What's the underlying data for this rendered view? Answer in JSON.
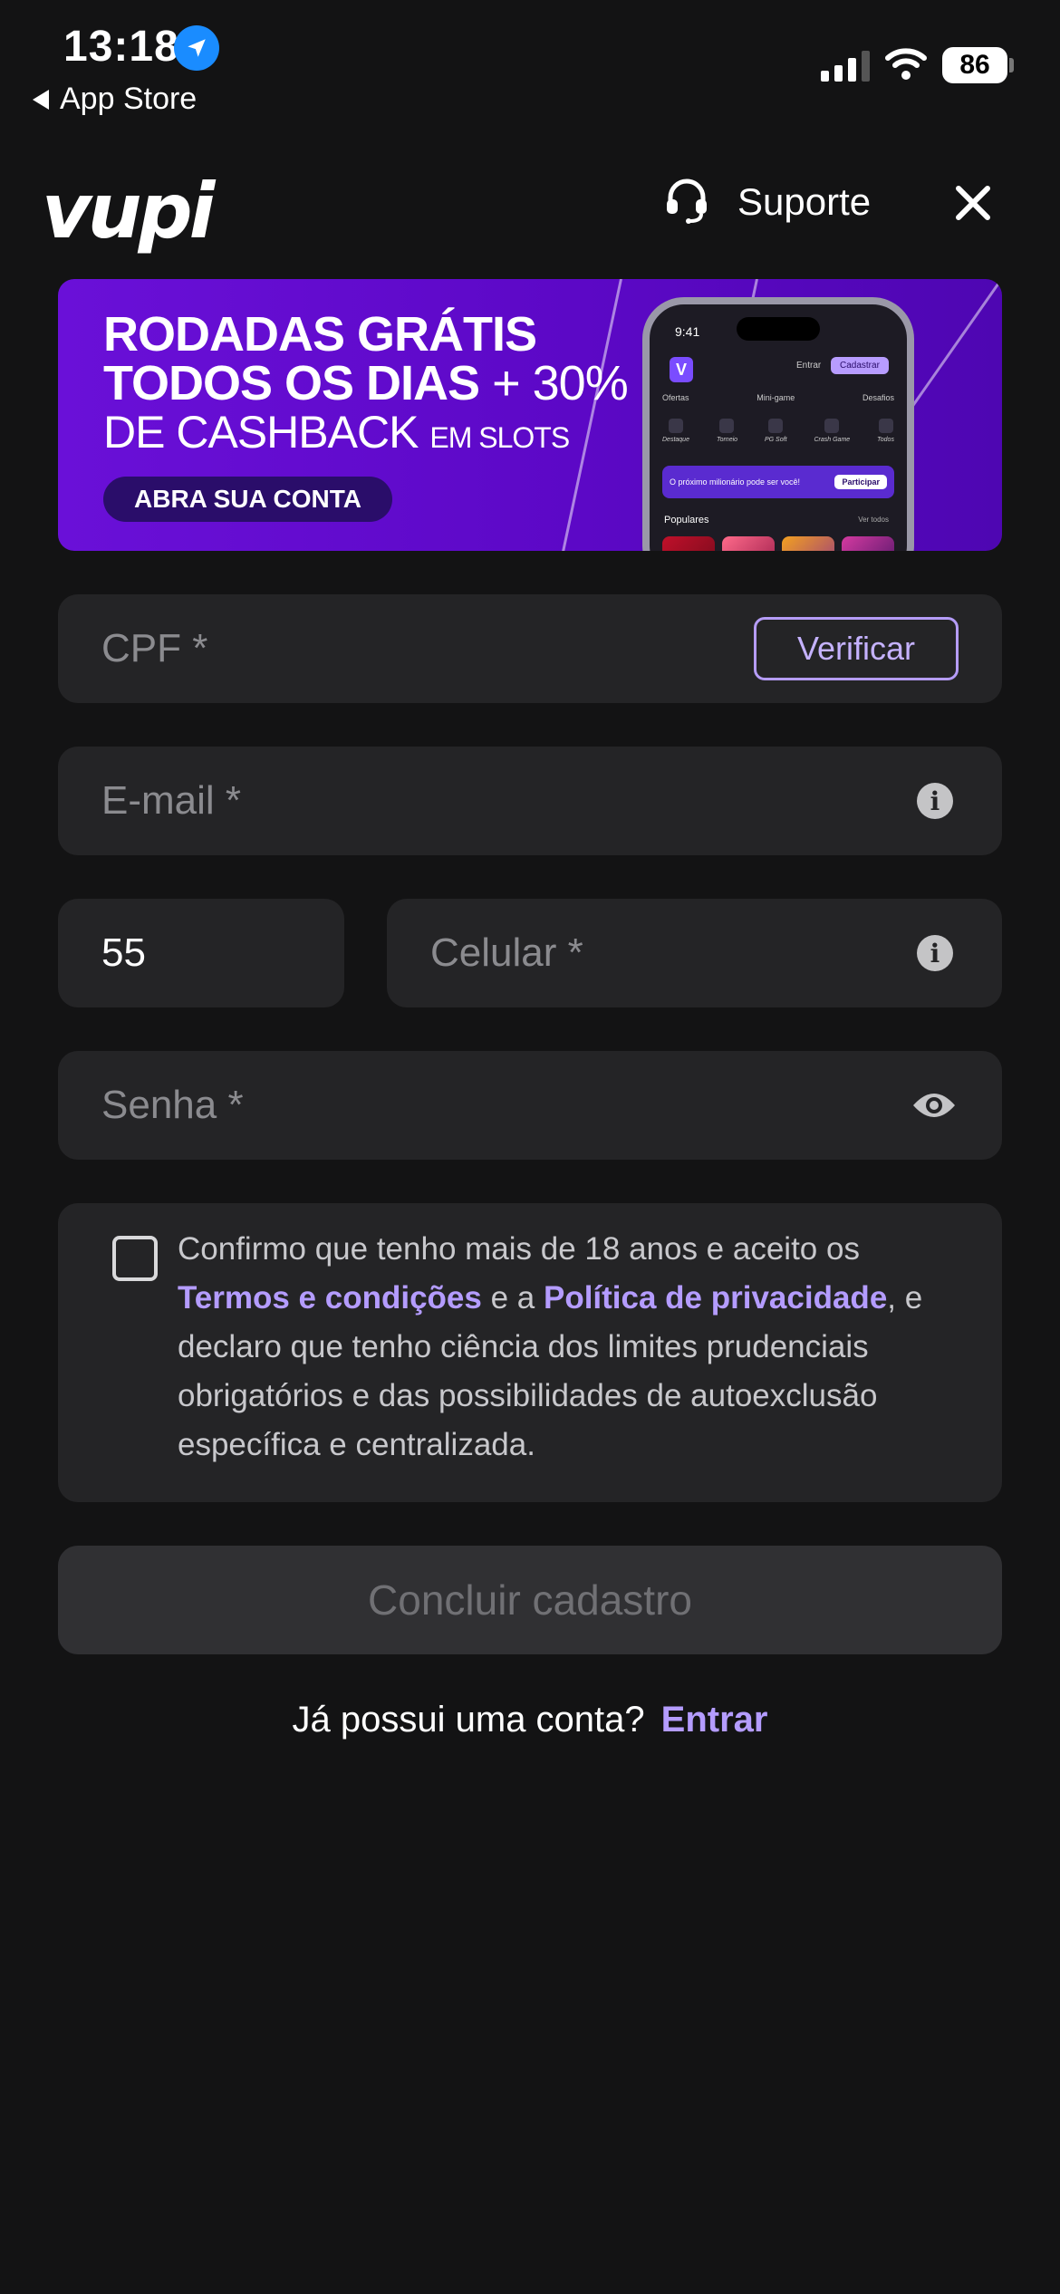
{
  "status_bar": {
    "time": "13:18",
    "back_label": "App Store",
    "battery": "86"
  },
  "header": {
    "logo": "vupi",
    "support_label": "Suporte"
  },
  "banner": {
    "line1": "RODADAS GRÁTIS",
    "line2": "TODOS OS DIAS",
    "line2_extra": "+ 30%",
    "line3": "DE CASHBACK",
    "line3_small": "EM SLOTS",
    "cta": "ABRA SUA CONTA",
    "phone": {
      "time": "9:41",
      "btn_login": "Entrar",
      "btn_register": "Cadastrar",
      "tabs": [
        "Ofertas",
        "Mini-game",
        "Desafios"
      ],
      "categories": [
        "Destaque",
        "Torneio",
        "PG Soft",
        "Crash Game",
        "Todos"
      ],
      "promo_text": "O próximo milionário pode ser você!",
      "promo_button": "Participar",
      "section_label": "Populares",
      "section_more": "Ver todos"
    }
  },
  "form": {
    "cpf_placeholder": "CPF *",
    "verify_label": "Verificar",
    "email_placeholder": "E-mail *",
    "ddi_value": "55",
    "phone_placeholder": "Celular *",
    "password_placeholder": "Senha *",
    "terms": {
      "part1": "Confirmo que tenho mais de 18 anos e aceito os",
      "link_terms": "Termos e condições",
      "part2": " e a ",
      "link_privacy": "Política de privacidade",
      "part3": ", e declaro que tenho ciência dos limites prudenciais obrigatórios e das possibilidades de autoexclusão específica e centralizada."
    },
    "submit_label": "Concluir cadastro"
  },
  "login_prompt": {
    "text": "Já possui uma conta?",
    "link": "Entrar"
  },
  "colors": {
    "background": "#131314",
    "field": "#242426",
    "accent": "#b49cff",
    "banner": "#6a10d8"
  }
}
